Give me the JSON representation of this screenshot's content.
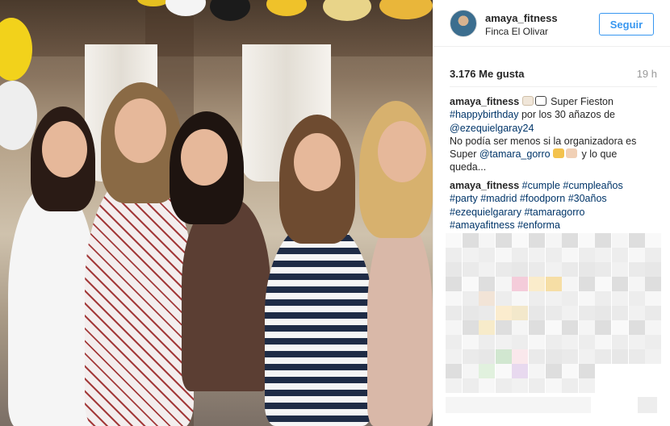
{
  "post": {
    "username": "amaya_fitness",
    "location": "Finca El Olivar",
    "follow_label": "Seguir",
    "likes": "3.176 Me gusta",
    "time_ago": "19 h"
  },
  "caption": {
    "author": "amaya_fitness",
    "text_1": " Super Fieston",
    "tag_1": "#happybirthday",
    "text_2": " por los 30 añazos de",
    "mention_1": "@ezequielgaray24",
    "text_3": "No podía ser menos si la organizadora es",
    "text_4": "Super ",
    "mention_2": "@tamara_gorro",
    "text_5": " y lo que",
    "text_6": "queda..."
  },
  "comment": {
    "author": "amaya_fitness",
    "tags_line_1": [
      "#cumple",
      "#cumpleaños"
    ],
    "tags_line_2": [
      "#party",
      "#madrid",
      "#foodporn",
      "#30años"
    ],
    "tags_line_3": [
      "#ezequielgarary",
      "#tamaragorro"
    ],
    "tags_line_4": [
      "#amayafitness",
      "#enforma"
    ]
  },
  "colors": {
    "accent": "#3897f0",
    "link": "#003569",
    "muted": "#999999"
  },
  "icons": {
    "avatar": "profile-avatar",
    "cake": "cake-emoji",
    "calendar": "calendar-emoji",
    "party": "party-popper-emoji",
    "clap": "clapping-hands-emoji"
  }
}
